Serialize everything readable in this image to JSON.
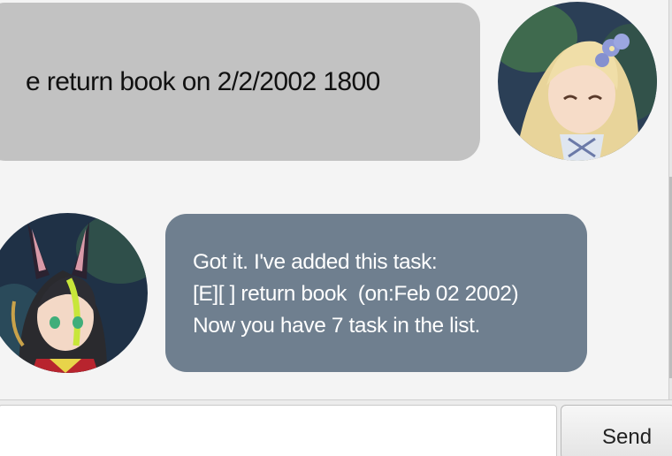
{
  "messages": [
    {
      "sender": "user",
      "text": "e return book on 2/2/2002 1800",
      "avatar": "blonde-character-avatar"
    },
    {
      "sender": "bot",
      "lines": [
        "Got it. I've added this task:",
        "[E][ ] return book  (on:Feb 02 2002)",
        "Now you have 7 task in the list."
      ],
      "avatar": "dark-haired-character-avatar"
    }
  ],
  "input": {
    "value": "",
    "placeholder": ""
  },
  "send_button": {
    "label": "Send"
  },
  "colors": {
    "background": "#f4f4f4",
    "user_bubble": "#c2c2c2",
    "bot_bubble": "#6f7f8f",
    "bot_text": "#ffffff"
  }
}
